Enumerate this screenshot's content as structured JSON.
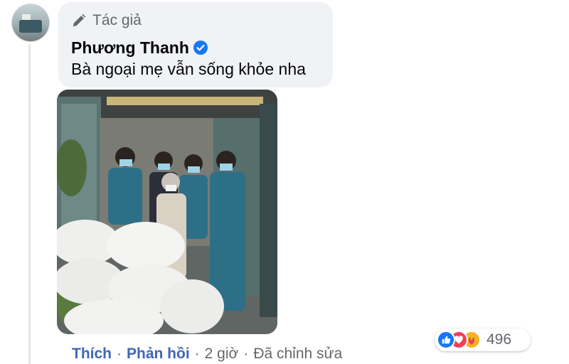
{
  "comment": {
    "badge_label": "Tác giả",
    "author_name": "Phương Thanh",
    "text": "Bà ngoại mẹ vẫn sống khỏe nha",
    "photo_alt": "Bà ngoại đứng cùng nhóm thanh niên tình nguyện trước cổng nhà bên các bao gạo"
  },
  "actions": {
    "like": "Thích",
    "reply": "Phản hồi",
    "separator": "·",
    "time": "2 giờ",
    "edited": "Đã chỉnh sửa"
  },
  "reactions": {
    "icons": [
      "like-icon",
      "love-icon",
      "care-icon"
    ],
    "count": "496"
  },
  "colors": {
    "bubble_bg": "#f0f2f5",
    "link_blue": "#4267b2",
    "verified_blue": "#1877f2",
    "meta_gray": "#65676b",
    "love_red": "#f33e58",
    "care_yellow": "#f7b125"
  }
}
